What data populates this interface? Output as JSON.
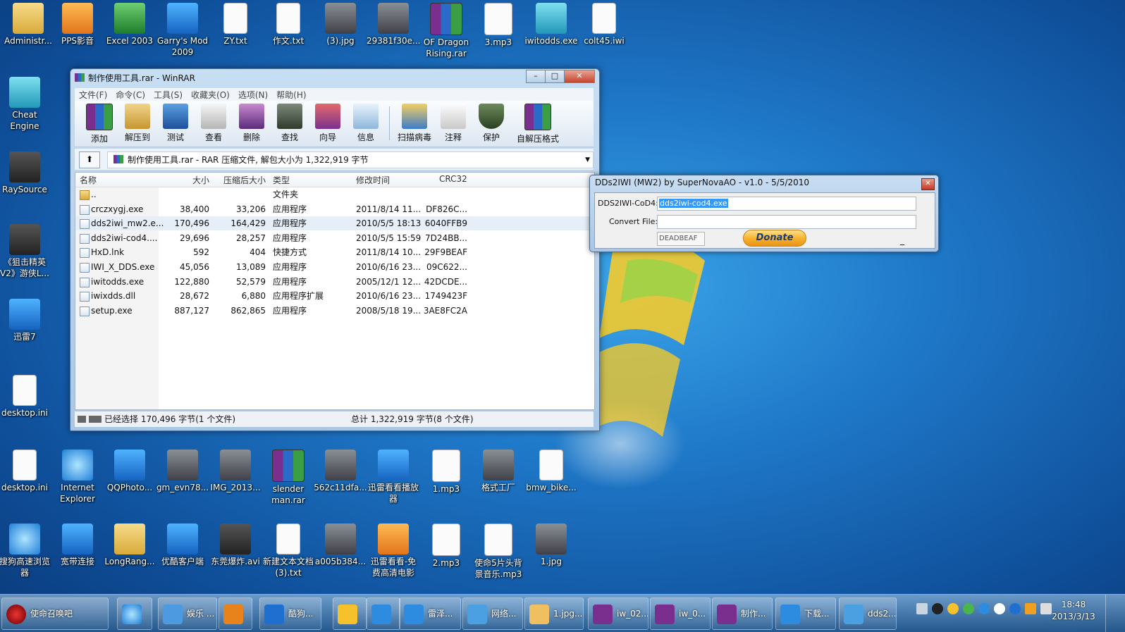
{
  "desktop_icons": [
    {
      "label": "Administr...",
      "icon": "user-folder-icon"
    },
    {
      "label": "PPS影音",
      "icon": "pps-icon"
    },
    {
      "label": "Excel 2003",
      "icon": "excel-icon"
    },
    {
      "label": "Garry's Mod 2009",
      "icon": "garrys-mod-icon"
    },
    {
      "label": "ZY.txt",
      "icon": "text-file-icon"
    },
    {
      "label": "作文.txt",
      "icon": "text-file-icon"
    },
    {
      "label": "(3).jpg",
      "icon": "image-file-icon"
    },
    {
      "label": "29381f30e...",
      "icon": "image-file-icon"
    },
    {
      "label": "OF Dragon Rising.rar",
      "icon": "rar-archive-icon"
    },
    {
      "label": "3.mp3",
      "icon": "mp3-file-icon"
    },
    {
      "label": "iwitodds.exe",
      "icon": "exe-file-icon"
    },
    {
      "label": "colt45.iwi",
      "icon": "file-icon"
    },
    {
      "label": "Cheat Engine",
      "icon": "cheat-engine-icon"
    },
    {
      "label": "RaySource",
      "icon": "raysource-icon"
    },
    {
      "label": "《狙击精英V2》游侠L...",
      "icon": "sniper-elite-icon"
    },
    {
      "label": "迅雷7",
      "icon": "xunlei-icon"
    },
    {
      "label": "desktop.ini",
      "icon": "ini-file-icon"
    },
    {
      "label": "desktop.ini",
      "icon": "ini-file-icon"
    },
    {
      "label": "Internet Explorer",
      "icon": "internet-explorer-icon"
    },
    {
      "label": "QQPhoto...",
      "icon": "qqphoto-icon"
    },
    {
      "label": "gm_evn78...",
      "icon": "image-file-icon"
    },
    {
      "label": "IMG_2013...",
      "icon": "image-file-icon"
    },
    {
      "label": "slender man.rar",
      "icon": "rar-archive-icon"
    },
    {
      "label": "562c11dfa...",
      "icon": "image-file-icon"
    },
    {
      "label": "迅雷看看播放器",
      "icon": "xunlei-player-icon"
    },
    {
      "label": "1.mp3",
      "icon": "mp3-file-icon"
    },
    {
      "label": "格式工厂",
      "icon": "format-factory-icon"
    },
    {
      "label": "bmw_bike...",
      "icon": "file-icon"
    },
    {
      "label": "搜狗高速浏览器",
      "icon": "sogou-browser-icon"
    },
    {
      "label": "宽带连接",
      "icon": "broadband-icon"
    },
    {
      "label": "LongRang...",
      "icon": "folder-icon"
    },
    {
      "label": "优酷客户端",
      "icon": "youku-icon"
    },
    {
      "label": "东莞爆炸.avi",
      "icon": "video-file-icon"
    },
    {
      "label": "新建文本文档 (3).txt",
      "icon": "text-file-icon"
    },
    {
      "label": "a005b384...",
      "icon": "image-file-icon"
    },
    {
      "label": "迅雷看看-免费高清电影",
      "icon": "xunlei-hd-icon"
    },
    {
      "label": "2.mp3",
      "icon": "mp3-file-icon"
    },
    {
      "label": "使命5片头背景音乐.mp3",
      "icon": "mp3-file-icon"
    },
    {
      "label": "1.jpg",
      "icon": "image-file-icon"
    }
  ],
  "winrar": {
    "title": "制作使用工具.rar - WinRAR",
    "menu": [
      "文件(F)",
      "命令(C)",
      "工具(S)",
      "收藏夹(O)",
      "选项(N)",
      "帮助(H)"
    ],
    "toolbar": [
      "添加",
      "解压到",
      "测试",
      "查看",
      "删除",
      "查找",
      "向导",
      "信息",
      "扫描病毒",
      "注释",
      "保护",
      "自解压格式"
    ],
    "path": "制作使用工具.rar - RAR 压缩文件, 解包大小为 1,322,919 字节",
    "columns": [
      "名称",
      "大小",
      "压缩后大小",
      "类型",
      "修改时间",
      "CRC32"
    ],
    "files": [
      {
        "name": "..",
        "size": "",
        "packed": "",
        "type": "文件夹",
        "modified": "",
        "crc": ""
      },
      {
        "name": "crczxygj.exe",
        "size": "38,400",
        "packed": "33,206",
        "type": "应用程序",
        "modified": "2011/8/14 11...",
        "crc": "DF826C..."
      },
      {
        "name": "dds2iwi_mw2.e...",
        "size": "170,496",
        "packed": "164,429",
        "type": "应用程序",
        "modified": "2010/5/5 18:13",
        "crc": "6040FFB9"
      },
      {
        "name": "dds2iwi-cod4....",
        "size": "29,696",
        "packed": "28,257",
        "type": "应用程序",
        "modified": "2010/5/5 15:59",
        "crc": "7D24BB..."
      },
      {
        "name": "HxD.lnk",
        "size": "592",
        "packed": "404",
        "type": "快捷方式",
        "modified": "2011/8/14 10...",
        "crc": "29F9BEAF"
      },
      {
        "name": "IWI_X_DDS.exe",
        "size": "45,056",
        "packed": "13,089",
        "type": "应用程序",
        "modified": "2010/6/16 23...",
        "crc": "09C622..."
      },
      {
        "name": "iwitodds.exe",
        "size": "122,880",
        "packed": "52,579",
        "type": "应用程序",
        "modified": "2005/12/1 12...",
        "crc": "42DCDE..."
      },
      {
        "name": "iwixdds.dll",
        "size": "28,672",
        "packed": "6,880",
        "type": "应用程序扩展",
        "modified": "2010/6/16 23...",
        "crc": "1749423F"
      },
      {
        "name": "setup.exe",
        "size": "887,127",
        "packed": "862,865",
        "type": "应用程序",
        "modified": "2008/5/18 19...",
        "crc": "3AE8FC2A"
      }
    ],
    "status_left": "已经选择 170,496 字节(1 个文件)",
    "status_right": "总计 1,322,919 字节(8 个文件)"
  },
  "dds2iwi": {
    "title": "DDs2IWI (MW2) by SuperNovaAO - v1.0 - 5/5/2010",
    "cod4_label": "DDS2IWI-CoD4:",
    "cod4_value": "dds2iwi-cod4.exe",
    "convert_label": "Convert File:",
    "convert_value": "",
    "deadbeaf": "DEADBEAF",
    "donate_label": "Donate",
    "minus": "_"
  },
  "taskbar": {
    "items": [
      "娱乐 ...",
      "酷狗...",
      "雷泽...",
      "网络...",
      "1.jpg...",
      "iw_02...",
      "iw_0...",
      "制作...",
      "下载...",
      "dds2..."
    ],
    "search_text": "使命召唤吧",
    "clock_time": "18:48",
    "clock_date": "2013/3/13"
  }
}
